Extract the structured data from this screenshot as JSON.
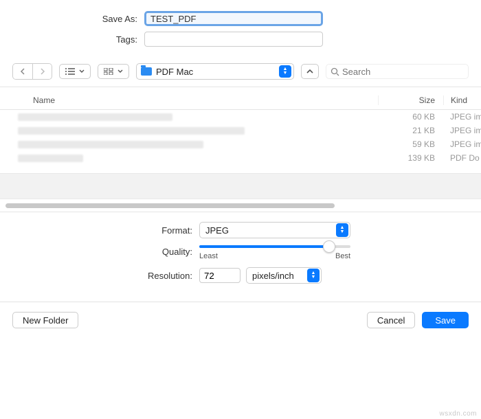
{
  "form": {
    "save_as_label": "Save As:",
    "save_as_value": "TEST_PDF",
    "tags_label": "Tags:",
    "tags_value": ""
  },
  "toolbar": {
    "location": "PDF Mac",
    "search_placeholder": "Search"
  },
  "columns": {
    "name": "Name",
    "size": "Size",
    "kind": "Kind"
  },
  "files": [
    {
      "blur_w": 225,
      "size": "60 KB",
      "kind": "JPEG im"
    },
    {
      "blur_w": 330,
      "size": "21 KB",
      "kind": "JPEG im"
    },
    {
      "blur_w": 270,
      "size": "59 KB",
      "kind": "JPEG im"
    },
    {
      "blur_w": 95,
      "size": "139 KB",
      "kind": "PDF Do"
    }
  ],
  "options": {
    "format_label": "Format:",
    "format_value": "JPEG",
    "quality_label": "Quality:",
    "quality_least": "Least",
    "quality_best": "Best",
    "resolution_label": "Resolution:",
    "resolution_value": "72",
    "resolution_unit": "pixels/inch"
  },
  "footer": {
    "new_folder": "New Folder",
    "cancel": "Cancel",
    "save": "Save"
  },
  "watermark": "wsxdn.com"
}
